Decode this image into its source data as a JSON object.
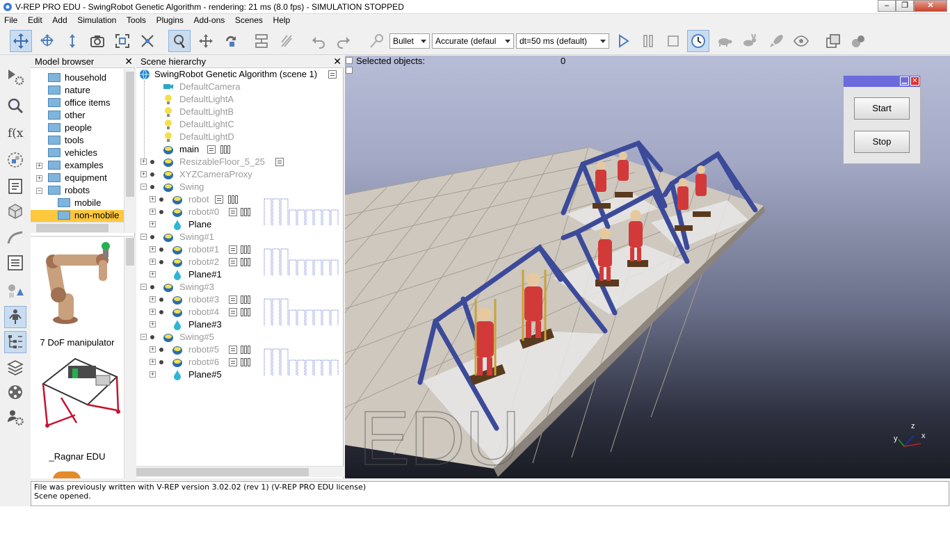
{
  "window": {
    "title": "V-REP PRO EDU - SwingRobot Genetic Algorithm - rendering: 21 ms (8.0 fps) - SIMULATION STOPPED",
    "minimize": "–",
    "maximize": "❐",
    "close": "✕"
  },
  "menu": [
    "File",
    "Edit",
    "Add",
    "Simulation",
    "Tools",
    "Plugins",
    "Add-ons",
    "Scenes",
    "Help"
  ],
  "toolbar": {
    "engine": "Bullet",
    "accuracy": "Accurate (defaul",
    "timestep": "dt=50 ms (default)"
  },
  "model_browser": {
    "title": "Model browser",
    "close": "✕",
    "folders": [
      {
        "label": "household",
        "expander": ""
      },
      {
        "label": "nature",
        "expander": ""
      },
      {
        "label": "office items",
        "expander": ""
      },
      {
        "label": "other",
        "expander": ""
      },
      {
        "label": "people",
        "expander": ""
      },
      {
        "label": "tools",
        "expander": ""
      },
      {
        "label": "vehicles",
        "expander": ""
      },
      {
        "label": "examples",
        "expander": "+"
      },
      {
        "label": "equipment",
        "expander": "+"
      },
      {
        "label": "robots",
        "expander": "−"
      },
      {
        "label": "mobile",
        "expander": ""
      },
      {
        "label": "non-mobile",
        "expander": ""
      }
    ],
    "models": [
      {
        "label": "7 DoF manipulator"
      },
      {
        "label": "_Ragnar EDU"
      }
    ]
  },
  "scene_hierarchy": {
    "title": "Scene hierarchy",
    "close": "✕",
    "root": "SwingRobot Genetic Algorithm (scene 1)",
    "items": [
      {
        "label": "DefaultCamera"
      },
      {
        "label": "DefaultLightA"
      },
      {
        "label": "DefaultLightB"
      },
      {
        "label": "DefaultLightC"
      },
      {
        "label": "DefaultLightD"
      },
      {
        "label": "main"
      },
      {
        "label": "ResizableFloor_5_25"
      },
      {
        "label": "XYZCameraProxy"
      },
      {
        "label": "Swing"
      },
      {
        "label": "robot"
      },
      {
        "label": "robot#0"
      },
      {
        "label": "Plane"
      },
      {
        "label": "Swing#1"
      },
      {
        "label": "robot#1"
      },
      {
        "label": "robot#2"
      },
      {
        "label": "Plane#1"
      },
      {
        "label": "Swing#3"
      },
      {
        "label": "robot#3"
      },
      {
        "label": "robot#4"
      },
      {
        "label": "Plane#3"
      },
      {
        "label": "Swing#5"
      },
      {
        "label": "robot#5"
      },
      {
        "label": "robot#6"
      },
      {
        "label": "Plane#5"
      }
    ]
  },
  "viewport": {
    "selected_label": "Selected objects:",
    "selected_count": "0",
    "watermark": "EDU",
    "axes": {
      "x": "x",
      "y": "y",
      "z": "z"
    }
  },
  "custom_ui": {
    "start": "Start",
    "stop": "Stop"
  },
  "console": {
    "lines": [
      "File was previously written with V-REP version 3.02.02 (rev 1) (V-REP PRO EDU license)",
      "Scene opened."
    ]
  },
  "colors": {
    "swing_frame": "#3c4a9a",
    "robot_body": "#d23a3a",
    "floor_tile": "#cfc8bf",
    "ui_titlebar": "#6c6bdc"
  }
}
